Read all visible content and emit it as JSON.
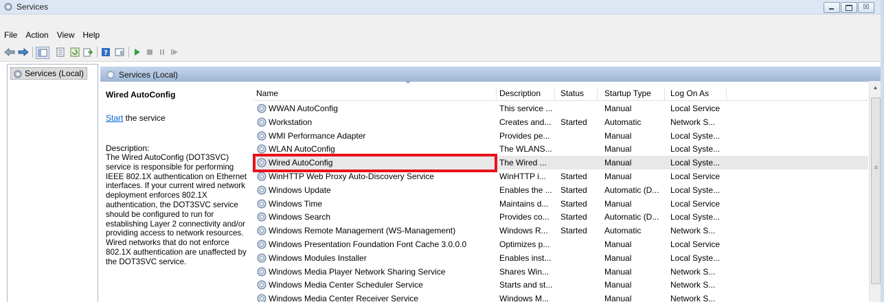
{
  "window": {
    "title": "Services",
    "minimize_icon": "minimize-icon",
    "maximize_icon": "maximize-icon",
    "close_glyph": "☒"
  },
  "menu": [
    "File",
    "Action",
    "View",
    "Help"
  ],
  "toolbar": {
    "icons": [
      "back-arrow-icon",
      "forward-arrow-icon",
      "show-hide-console-tree-icon",
      "properties-icon",
      "refresh-icon",
      "export-list-icon",
      "help-icon",
      "show-hide-action-pane-icon",
      "start-service-icon",
      "stop-service-icon",
      "pause-service-icon",
      "resume-service-icon"
    ]
  },
  "tree": {
    "item": "Services (Local)"
  },
  "pane": {
    "header": "Services (Local)"
  },
  "description": {
    "service_name": "Wired AutoConfig",
    "start_link": "Start",
    "start_suffix": " the service",
    "label": "Description:",
    "text": "The Wired AutoConfig (DOT3SVC) service is responsible for performing IEEE 802.1X authentication on Ethernet interfaces. If your current wired network deployment enforces 802.1X authentication, the DOT3SVC service should be configured to run for establishing Layer 2 connectivity and/or providing access to network resources. Wired networks that do not enforce 802.1X authentication are unaffected by the DOT3SVC service."
  },
  "columns": [
    "Name",
    "Description",
    "Status",
    "Startup Type",
    "Log On As"
  ],
  "rows": [
    [
      "WWAN AutoConfig",
      "This service ...",
      "",
      "Manual",
      "Local Service"
    ],
    [
      "Workstation",
      "Creates and...",
      "Started",
      "Automatic",
      "Network S..."
    ],
    [
      "WMI Performance Adapter",
      "Provides pe...",
      "",
      "Manual",
      "Local Syste..."
    ],
    [
      "WLAN AutoConfig",
      "The WLANS...",
      "",
      "Manual",
      "Local Syste..."
    ],
    [
      "Wired AutoConfig",
      "The Wired ...",
      "",
      "Manual",
      "Local Syste..."
    ],
    [
      "WinHTTP Web Proxy Auto-Discovery Service",
      "WinHTTP i...",
      "Started",
      "Manual",
      "Local Service"
    ],
    [
      "Windows Update",
      "Enables the ...",
      "Started",
      "Automatic (D...",
      "Local Syste..."
    ],
    [
      "Windows Time",
      "Maintains d...",
      "Started",
      "Manual",
      "Local Service"
    ],
    [
      "Windows Search",
      "Provides co...",
      "Started",
      "Automatic (D...",
      "Local Syste..."
    ],
    [
      "Windows Remote Management (WS-Management)",
      "Windows R...",
      "Started",
      "Automatic",
      "Network S..."
    ],
    [
      "Windows Presentation Foundation Font Cache 3.0.0.0",
      "Optimizes p...",
      "",
      "Manual",
      "Local Service"
    ],
    [
      "Windows Modules Installer",
      "Enables inst...",
      "",
      "Manual",
      "Local Syste..."
    ],
    [
      "Windows Media Player Network Sharing Service",
      "Shares Win...",
      "",
      "Manual",
      "Network S..."
    ],
    [
      "Windows Media Center Scheduler Service",
      "Starts and st...",
      "",
      "Manual",
      "Network S..."
    ],
    [
      "Windows Media Center Receiver Service",
      "Windows M...",
      "",
      "Manual",
      "Network S..."
    ]
  ],
  "selected_row": "Wired AutoConfig",
  "highlight_color": "#e8131c",
  "scrollbar": {
    "up_glyph": "▲",
    "grip_glyph": "≡"
  }
}
